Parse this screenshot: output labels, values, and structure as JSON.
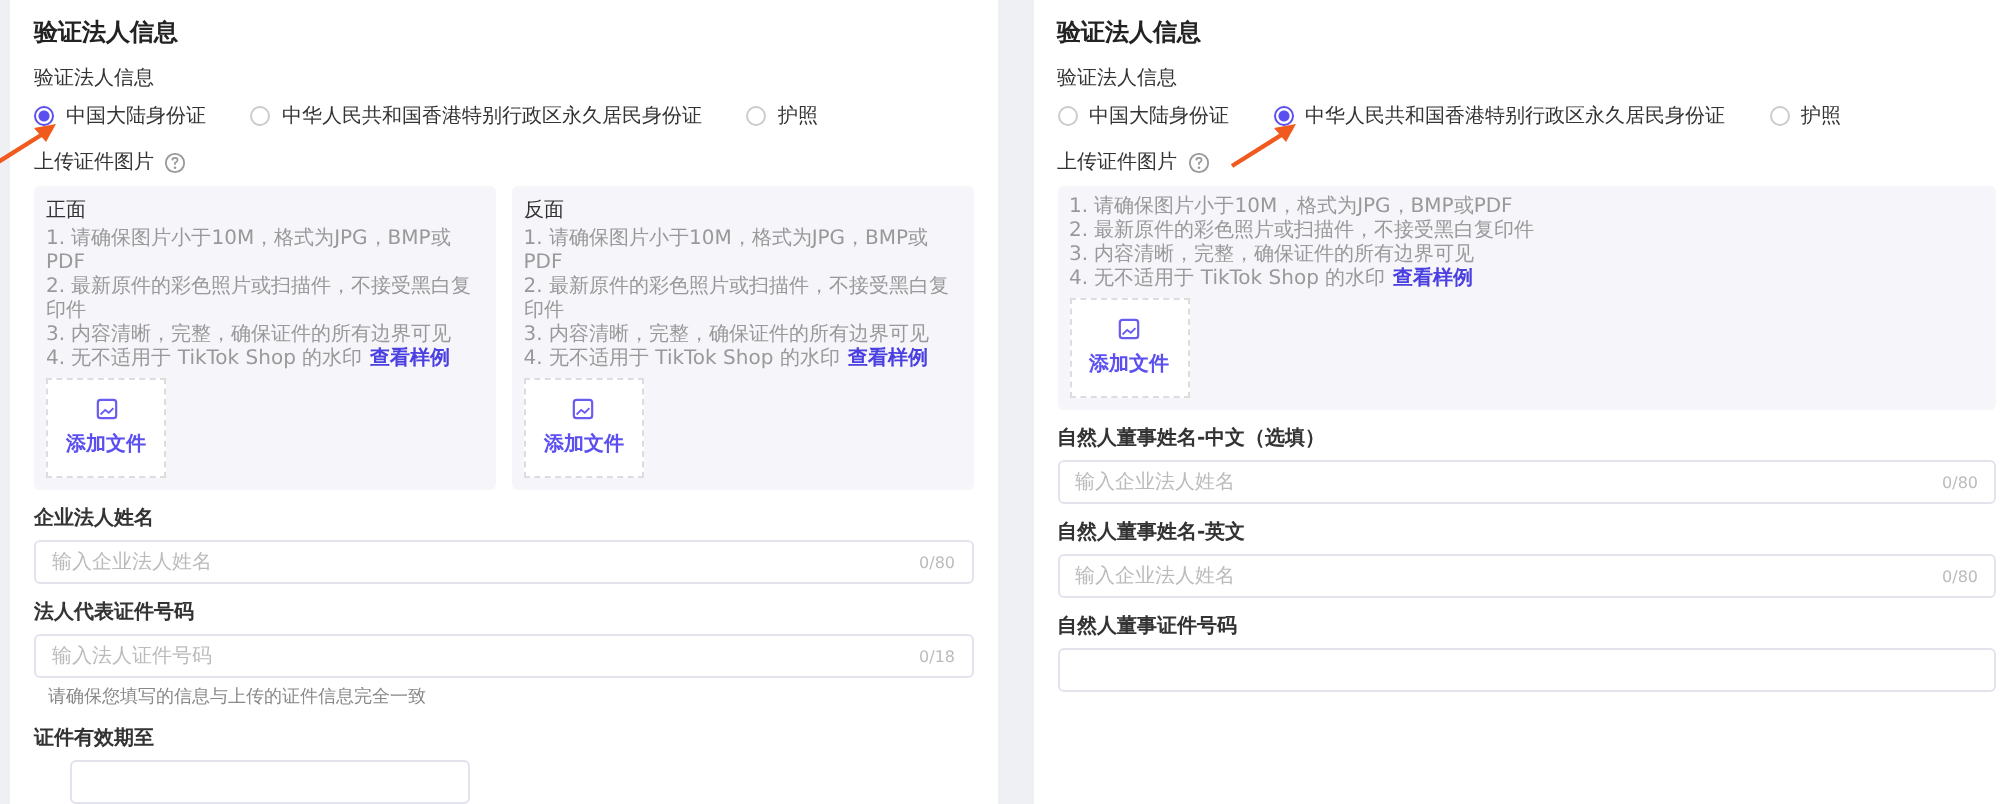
{
  "panels": [
    {
      "title": "验证法人信息",
      "radio_group": {
        "label": "验证法人信息",
        "options": [
          {
            "label": "中国大陆身份证",
            "selected": true
          },
          {
            "label": "中华人民共和国香港特别行政区永久居民身份证",
            "selected": false
          },
          {
            "label": "护照",
            "selected": false
          }
        ]
      },
      "annotated": true,
      "upload": {
        "label": "上传证件图片",
        "sides": [
          {
            "title": "正面",
            "tips": [
              "1. 请确保图片小于10M，格式为JPG，BMP或PDF",
              "2. 最新原件的彩色照片或扫描件，不接受黑白复印件",
              "3. 内容清晰，完整，确保证件的所有边界可见",
              "4. 无不适用于 TikTok Shop 的水印"
            ],
            "link": "查看样例",
            "button": "添加文件"
          },
          {
            "title": "反面",
            "tips": [
              "1. 请确保图片小于10M，格式为JPG，BMP或PDF",
              "2. 最新原件的彩色照片或扫描件，不接受黑白复印件",
              "3. 内容清晰，完整，确保证件的所有边界可见",
              "4. 无不适用于 TikTok Shop 的水印"
            ],
            "link": "查看样例",
            "button": "添加文件"
          }
        ]
      },
      "fields": [
        {
          "kind": "text",
          "label": "企业法人姓名",
          "placeholder": "输入企业法人姓名",
          "counter": "0/80"
        },
        {
          "kind": "text",
          "label": "法人代表证件号码",
          "placeholder": "输入法人证件号码",
          "counter": "0/18",
          "hint": "请确保您填写的信息与上传的证件信息完全一致"
        },
        {
          "kind": "date",
          "label": "证件有效期至"
        }
      ]
    },
    {
      "title": "验证法人信息",
      "radio_group": {
        "label": "验证法人信息",
        "options": [
          {
            "label": "中国大陆身份证",
            "selected": false
          },
          {
            "label": "中华人民共和国香港特别行政区永久居民身份证",
            "selected": true
          },
          {
            "label": "护照",
            "selected": false
          }
        ]
      },
      "annotated": true,
      "upload": {
        "label": "上传证件图片",
        "sides": [
          {
            "tips": [
              "1. 请确保图片小于10M，格式为JPG，BMP或PDF",
              "2. 最新原件的彩色照片或扫描件，不接受黑白复印件",
              "3. 内容清晰，完整，确保证件的所有边界可见",
              "4. 无不适用于 TikTok Shop 的水印"
            ],
            "link": "查看样例",
            "button": "添加文件"
          }
        ]
      },
      "fields": [
        {
          "kind": "text",
          "label": "自然人董事姓名-中文（选填）",
          "placeholder": "输入企业法人姓名",
          "counter": "0/80"
        },
        {
          "kind": "text",
          "label": "自然人董事姓名-英文",
          "placeholder": "输入企业法人姓名",
          "counter": "0/80"
        },
        {
          "kind": "text",
          "label": "自然人董事证件号码"
        }
      ]
    }
  ]
}
